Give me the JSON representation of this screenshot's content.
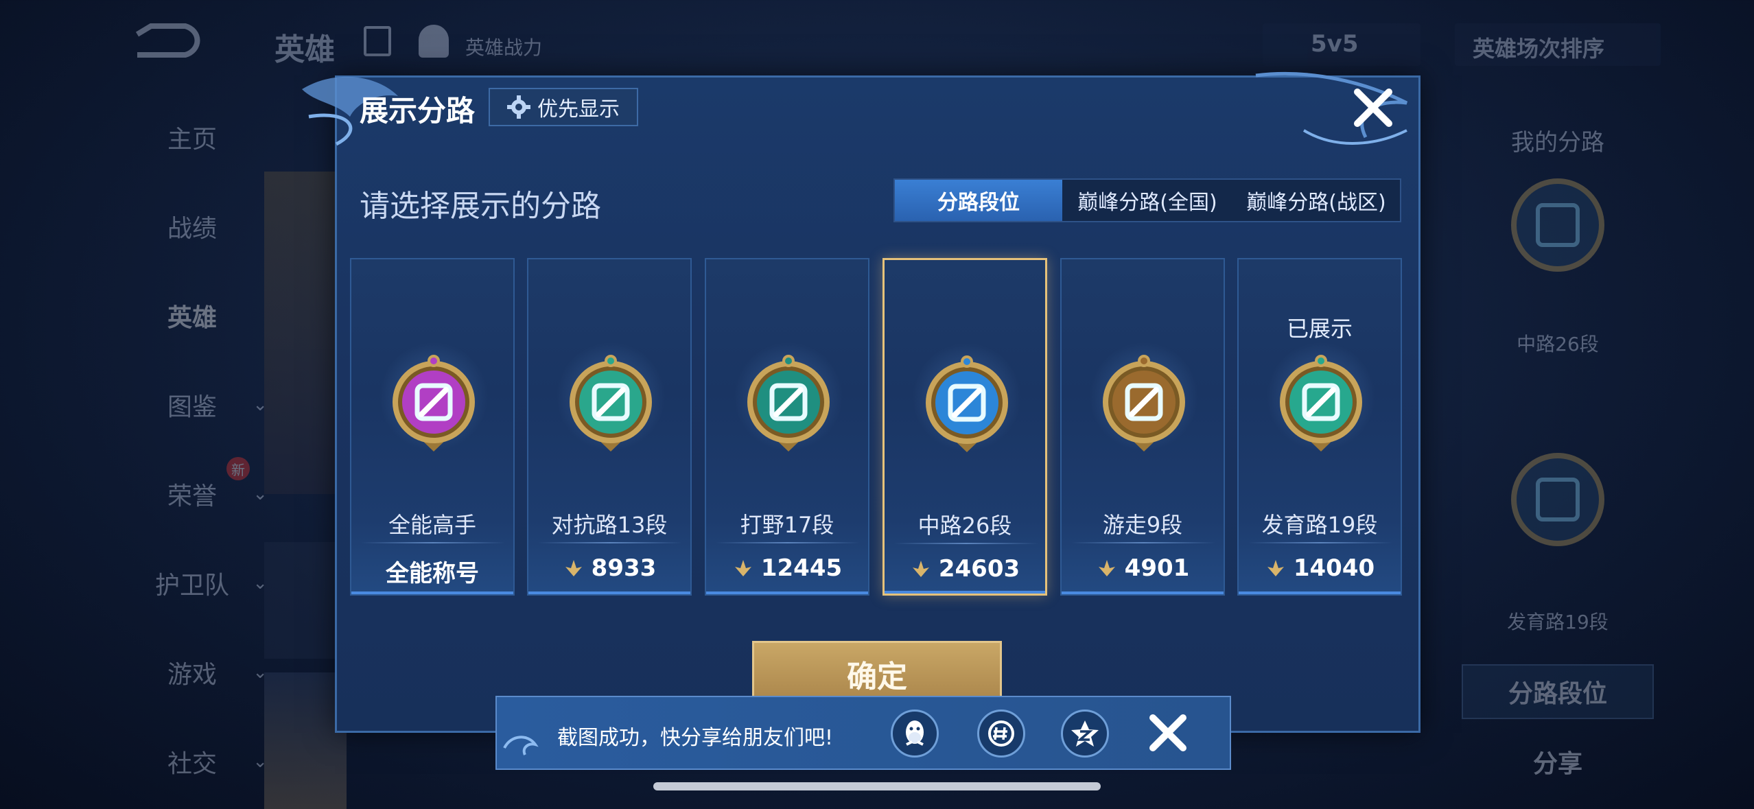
{
  "background": {
    "title": "英雄",
    "power_label": "英雄战力",
    "mode_select": "5v5",
    "sort_select": "英雄场次排序",
    "nav": [
      "主页",
      "战绩",
      "英雄",
      "图鉴",
      "荣誉",
      "护卫队",
      "游戏",
      "社交"
    ],
    "new_badge": "新",
    "right_panel": {
      "title": "我的分路",
      "badge1_label": "中路26段",
      "badge2_label": "发育路19段",
      "btn_rank": "分路段位",
      "btn_share": "分享"
    }
  },
  "modal": {
    "title": "展示分路",
    "pref_button": "优先显示",
    "prompt": "请选择展示的分路",
    "tabs": [
      "分路段位",
      "巅峰分路(全国)",
      "巅峰分路(战区)"
    ],
    "active_tab": 0,
    "cards": [
      {
        "name": "全能高手",
        "score": "全能称号",
        "icon": "all-round-medal-icon",
        "color": "#b13fc4",
        "shown": "",
        "selected": false
      },
      {
        "name": "对抗路13段",
        "score": "8933",
        "icon": "clash-lane-medal-icon",
        "color": "#2aa78c",
        "shown": "",
        "selected": false
      },
      {
        "name": "打野17段",
        "score": "12445",
        "icon": "jungle-medal-icon",
        "color": "#1f8f80",
        "shown": "",
        "selected": false
      },
      {
        "name": "中路26段",
        "score": "24603",
        "icon": "mid-lane-medal-icon",
        "color": "#2c86d8",
        "shown": "",
        "selected": true
      },
      {
        "name": "游走9段",
        "score": "4901",
        "icon": "roam-medal-icon",
        "color": "#9a6a2e",
        "shown": "",
        "selected": false
      },
      {
        "name": "发育路19段",
        "score": "14040",
        "icon": "farm-lane-medal-icon",
        "color": "#27a88e",
        "shown": "已展示",
        "selected": false
      }
    ],
    "confirm": "确定"
  },
  "toast": {
    "text": "截图成功，快分享给朋友们吧!",
    "icons": [
      "qq-icon",
      "wechat-moments-icon",
      "qzone-icon"
    ]
  }
}
